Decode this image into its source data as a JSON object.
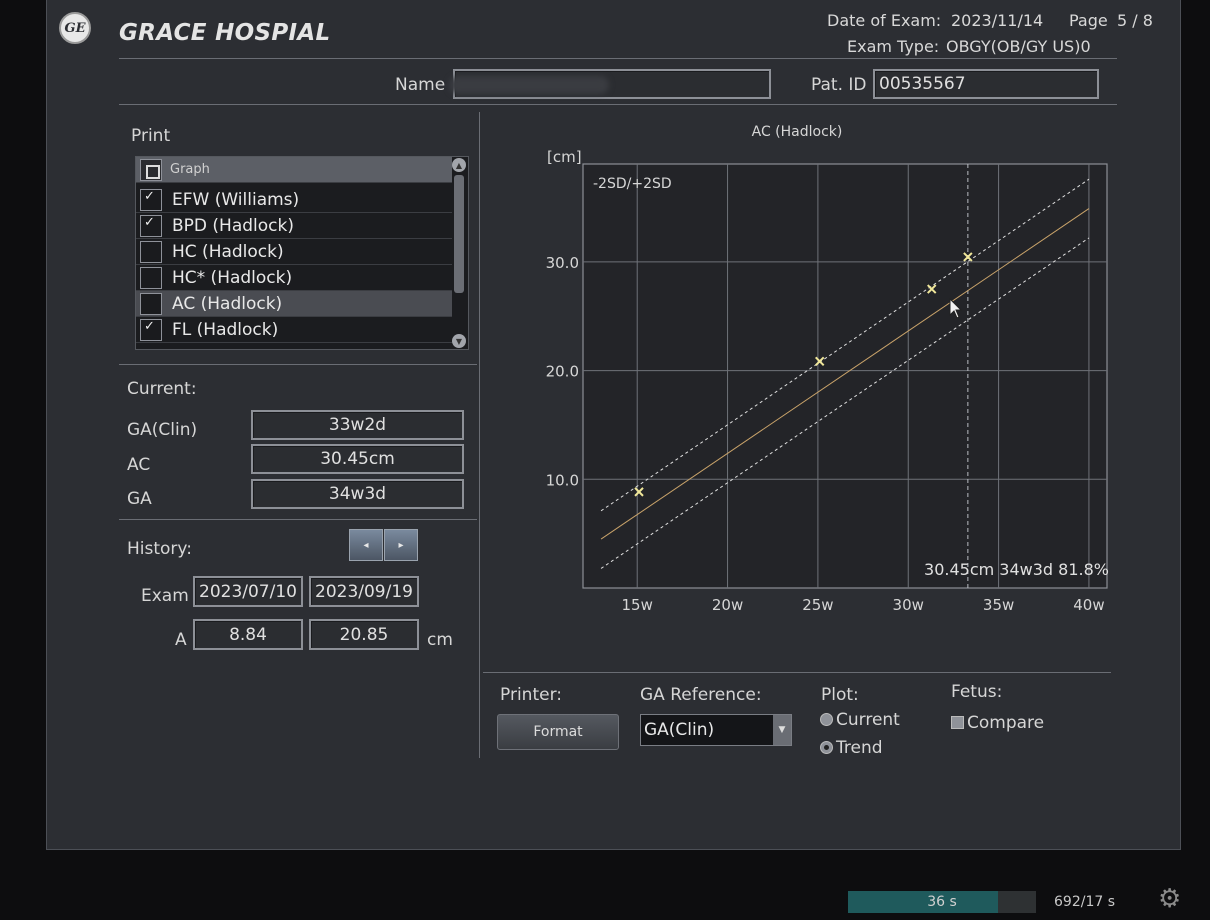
{
  "header": {
    "logo_text": "GE",
    "hospital": "GRACE HOSPIAL",
    "date_label": "Date of Exam:",
    "date_value": "2023/11/14",
    "page_label": "Page",
    "page_value": "5 / 8",
    "exam_type_label": "Exam Type:",
    "exam_type_value": "OBGY(OB/GY US)0"
  },
  "patient": {
    "name_label": "Name",
    "name_value": "",
    "id_label": "Pat. ID",
    "id_value": "00535567"
  },
  "print": {
    "title": "Print",
    "header_label": "Graph",
    "items": [
      {
        "label": "EFW (Williams)",
        "mark": "✓"
      },
      {
        "label": "BPD (Hadlock)",
        "mark": "✓"
      },
      {
        "label": "HC (Hadlock)",
        "mark": ""
      },
      {
        "label": "HC* (Hadlock)",
        "mark": ""
      },
      {
        "label": "AC (Hadlock)",
        "mark": ""
      },
      {
        "label": "FL (Hadlock)",
        "mark": "✓"
      }
    ]
  },
  "current": {
    "title": "Current:",
    "ga_clin_label": "GA(Clin)",
    "ga_clin_value": "33w2d",
    "ac_label": "AC",
    "ac_value": "30.45cm",
    "ga_label": "GA",
    "ga_value": "34w3d"
  },
  "history": {
    "title": "History:",
    "prev_icon": "◂",
    "next_icon": "▸",
    "exam_label": "Exam",
    "exam_dates": [
      "2023/07/10",
      "2023/09/19"
    ],
    "a_label": "A",
    "a_values": [
      "8.84",
      "20.85"
    ],
    "unit": "cm"
  },
  "controls": {
    "printer_label": "Printer:",
    "format_label": "Format",
    "ga_ref_label": "GA Reference:",
    "ga_ref_value": "GA(Clin)",
    "plot_label": "Plot:",
    "plot_current": "Current",
    "plot_trend": "Trend",
    "fetus_label": "Fetus:",
    "fetus_compare": "Compare"
  },
  "status": {
    "timer": "36 s",
    "progress": 0.8,
    "counter": "692/17 s"
  },
  "chart_data": {
    "type": "line",
    "title": "AC (Hadlock)",
    "ylabel": "[cm]",
    "band_label": "-2SD/+2SD",
    "readout": "30.45cm 34w3d 81.8%",
    "x_unit": "weeks",
    "x_ticks": [
      15,
      20,
      25,
      30,
      35,
      40
    ],
    "x_tick_labels": [
      "15w",
      "20w",
      "25w",
      "30w",
      "35w",
      "40w"
    ],
    "y_ticks": [
      10,
      20,
      30
    ],
    "y_tick_labels": [
      "10.0",
      "20.0",
      "30.0"
    ],
    "xlim": [
      12,
      41
    ],
    "ylim": [
      0,
      39
    ],
    "grid": true,
    "current_marker_x": 33.3,
    "series": [
      {
        "role": "mean",
        "x": [
          13,
          40
        ],
        "y": [
          4.5,
          34.9
        ],
        "color": "#c9a36a"
      },
      {
        "role": "upper",
        "x": [
          13,
          40
        ],
        "y": [
          7.1,
          37.6
        ],
        "color": "#e0e0e0"
      },
      {
        "role": "lower",
        "x": [
          13,
          40
        ],
        "y": [
          1.8,
          32.2
        ],
        "color": "#e0e0e0"
      }
    ],
    "points": [
      {
        "x": 15.1,
        "y": 8.84
      },
      {
        "x": 25.1,
        "y": 20.85
      },
      {
        "x": 31.3,
        "y": 27.5
      },
      {
        "x": 33.3,
        "y": 30.45
      }
    ],
    "point_color": "#f0e79a"
  }
}
